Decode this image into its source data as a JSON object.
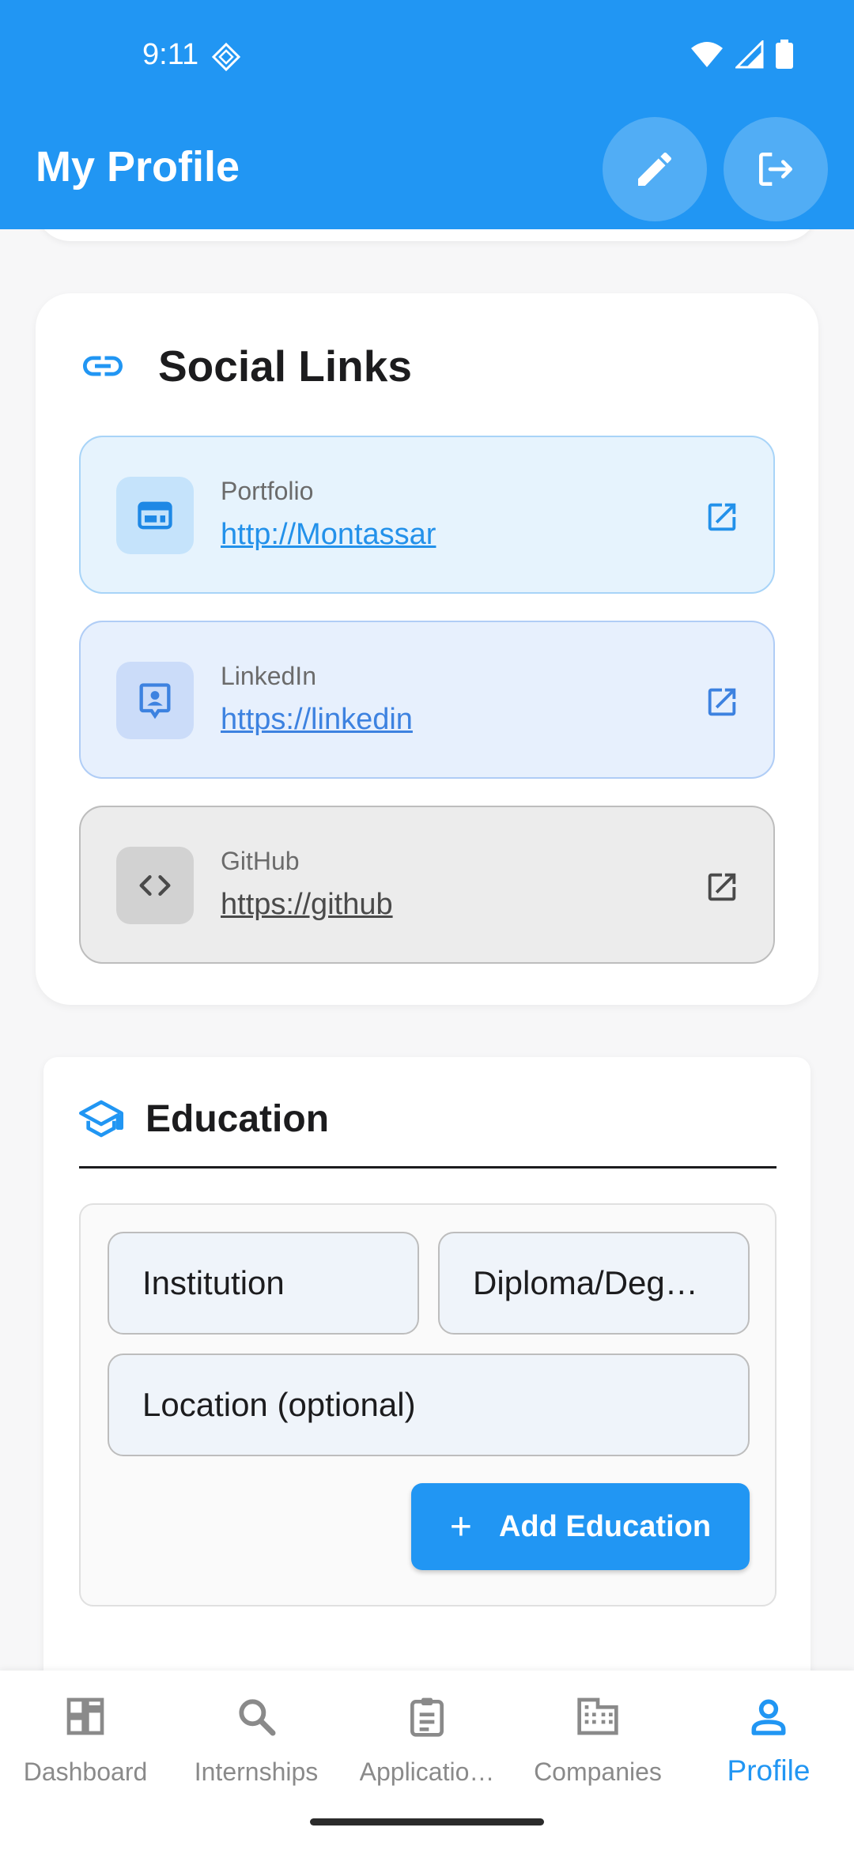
{
  "status_bar": {
    "time": "9:11"
  },
  "app_bar": {
    "title": "My Profile",
    "edit_icon": "pencil-icon",
    "logout_icon": "logout-icon"
  },
  "social_links": {
    "title": "Social Links",
    "icon": "link-icon",
    "items": [
      {
        "label": "Portfolio",
        "url": "http://Montassar",
        "icon": "web-icon"
      },
      {
        "label": "LinkedIn",
        "url": "https://linkedin",
        "icon": "contact-card-icon"
      },
      {
        "label": "GitHub",
        "url": "https://github",
        "icon": "code-icon"
      }
    ]
  },
  "education": {
    "title": "Education",
    "icon": "graduation-cap-icon",
    "fields": {
      "institution_placeholder": "Institution",
      "diploma_placeholder": "Diploma/Deg…",
      "location_placeholder": "Location (optional)"
    },
    "add_button": "Add Education"
  },
  "bottom_nav": {
    "items": [
      {
        "label": "Dashboard",
        "icon": "dashboard-icon"
      },
      {
        "label": "Internships",
        "icon": "search-icon"
      },
      {
        "label": "Applicatio…",
        "icon": "clipboard-icon"
      },
      {
        "label": "Companies",
        "icon": "building-icon"
      },
      {
        "label": "Profile",
        "icon": "person-icon",
        "active": true
      }
    ]
  },
  "colors": {
    "primary": "#2196f3",
    "portfolio_bg": "#e6f3fd",
    "linkedin_bg": "#e7f0fd",
    "github_bg": "#ececec"
  }
}
